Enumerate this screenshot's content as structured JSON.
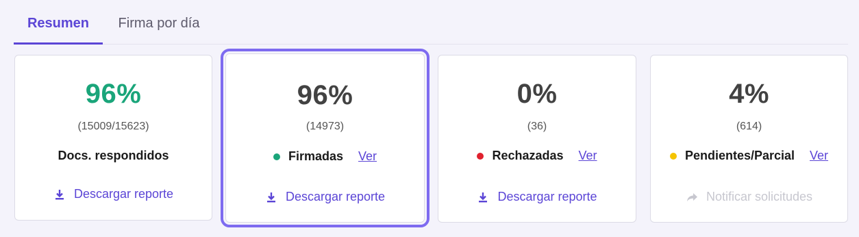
{
  "tabs": [
    {
      "label": "Resumen",
      "active": true
    },
    {
      "label": "Firma por día",
      "active": false
    }
  ],
  "cards": [
    {
      "percent": "96%",
      "count": "(15009/15623)",
      "label": "Docs. respondidos",
      "action": "Descargar reporte",
      "action_icon": "download-icon",
      "accent": "#1aa57a"
    },
    {
      "percent": "96%",
      "count": "(14973)",
      "label": "Firmadas",
      "link": "Ver",
      "dot_color": "#1aa57a",
      "action": "Descargar reporte",
      "action_icon": "download-icon",
      "selected": true
    },
    {
      "percent": "0%",
      "count": "(36)",
      "label": "Rechazadas",
      "link": "Ver",
      "dot_color": "#e0212e",
      "action": "Descargar reporte",
      "action_icon": "download-icon"
    },
    {
      "percent": "4%",
      "count": "(614)",
      "label": "Pendientes/Parcial",
      "link": "Ver",
      "dot_color": "#f5c400",
      "action": "Notificar solicitudes",
      "action_icon": "share-arrow-icon",
      "action_disabled": true
    }
  ],
  "colors": {
    "primary": "#5b45d6",
    "selected_outline": "#7e6bf0",
    "background": "#f4f3fb"
  }
}
